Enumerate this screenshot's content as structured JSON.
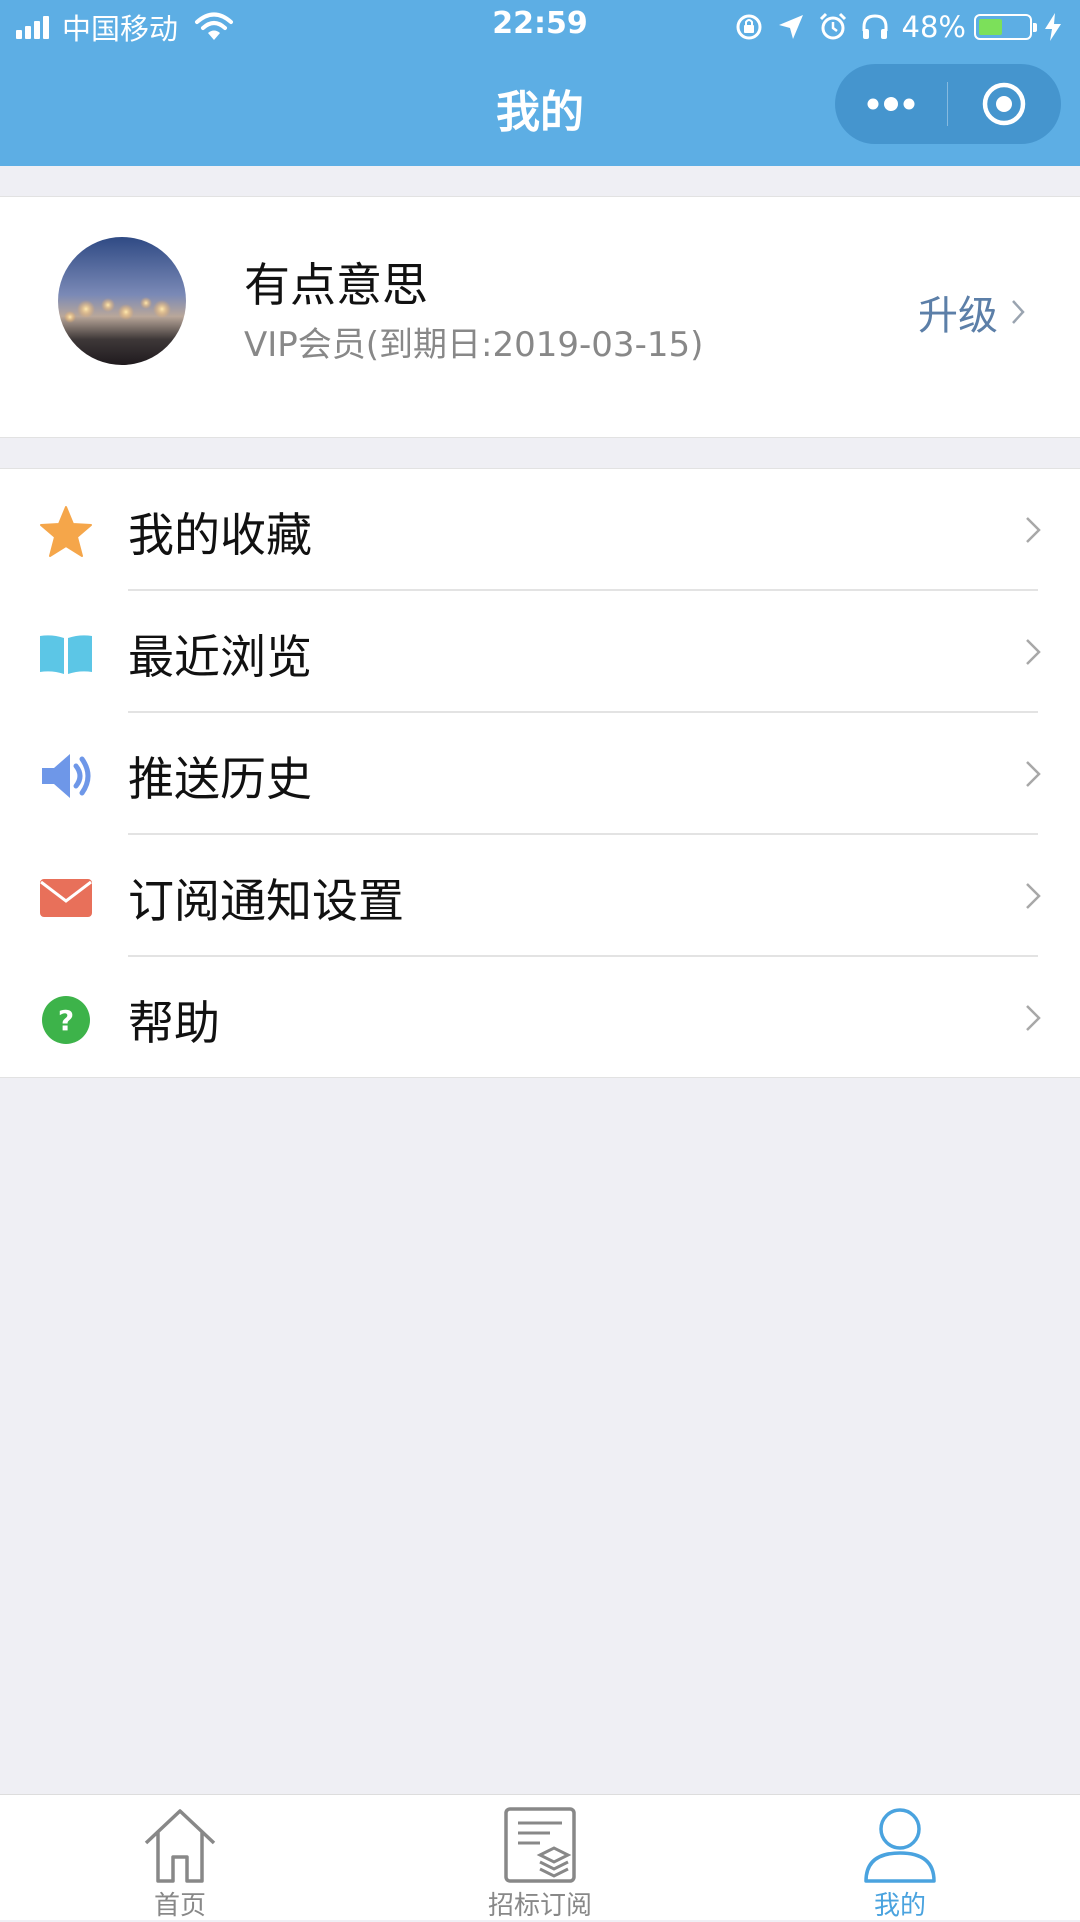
{
  "status_bar": {
    "carrier": "中国移动",
    "time": "22:59",
    "battery_percent_label": "48%",
    "battery_level": 0.48
  },
  "header": {
    "title": "我的",
    "background_color": "#5DAEE4"
  },
  "profile": {
    "username": "有点意思",
    "membership": "VIP会员(到期日:2019-03-15)",
    "upgrade_label": "升级"
  },
  "menu": {
    "items": [
      {
        "label": "我的收藏",
        "icon": "star-icon",
        "icon_color": "#F5A64A"
      },
      {
        "label": "最近浏览",
        "icon": "book-icon",
        "icon_color": "#5CC6E6"
      },
      {
        "label": "推送历史",
        "icon": "speaker-icon",
        "icon_color": "#6E97E8"
      },
      {
        "label": "订阅通知设置",
        "icon": "mail-icon",
        "icon_color": "#E8705A"
      },
      {
        "label": "帮助",
        "icon": "help-icon",
        "icon_color": "#3DB34A"
      }
    ]
  },
  "tabbar": {
    "items": [
      {
        "label": "首页",
        "icon": "home-icon",
        "active": false
      },
      {
        "label": "招标订阅",
        "icon": "document-icon",
        "active": false
      },
      {
        "label": "我的",
        "icon": "user-icon",
        "active": true
      }
    ],
    "active_color": "#4AA3DF",
    "inactive_color": "#888888"
  }
}
